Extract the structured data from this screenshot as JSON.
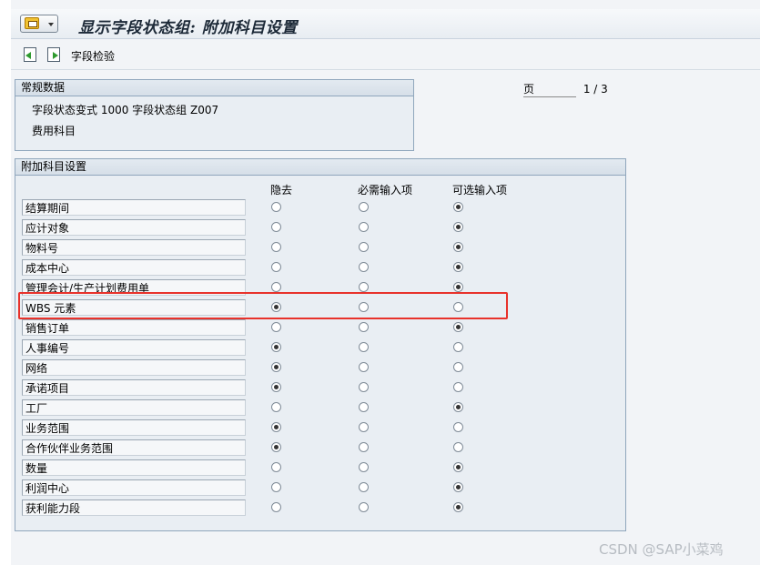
{
  "window": {
    "title": "显示字段状态组: 附加科目设置"
  },
  "toolbar": {
    "field_check_label": "字段检验"
  },
  "general_data": {
    "header": "常规数据",
    "line1": "字段状态变式 1000  字段状态组 Z007",
    "line2": "费用科目"
  },
  "pagination": {
    "label": "页",
    "value": "1 / 3"
  },
  "additional_settings": {
    "header": "附加科目设置",
    "columns": [
      "隐去",
      "必需输入项",
      "可选输入项"
    ],
    "rows": [
      {
        "label": "结算期间",
        "selected": 2
      },
      {
        "label": "应计对象",
        "selected": 2
      },
      {
        "label": "物料号",
        "selected": 2
      },
      {
        "label": "成本中心",
        "selected": 2
      },
      {
        "label": "管理会计/生产计划费用单",
        "selected": 2
      },
      {
        "label": "WBS 元素",
        "selected": 0
      },
      {
        "label": "销售订单",
        "selected": 2
      },
      {
        "label": "人事编号",
        "selected": 0
      },
      {
        "label": "网络",
        "selected": 0
      },
      {
        "label": "承诺项目",
        "selected": 0
      },
      {
        "label": "工厂",
        "selected": 2
      },
      {
        "label": "业务范围",
        "selected": 0
      },
      {
        "label": "合作伙伴业务范围",
        "selected": 0
      },
      {
        "label": "数量",
        "selected": 2
      },
      {
        "label": "利润中心",
        "selected": 2
      },
      {
        "label": "获利能力段",
        "selected": 2
      }
    ]
  },
  "watermark": "CSDN @SAP小菜鸡",
  "colors": {
    "highlight": "#e8322b",
    "background": "#f2f4f7"
  }
}
